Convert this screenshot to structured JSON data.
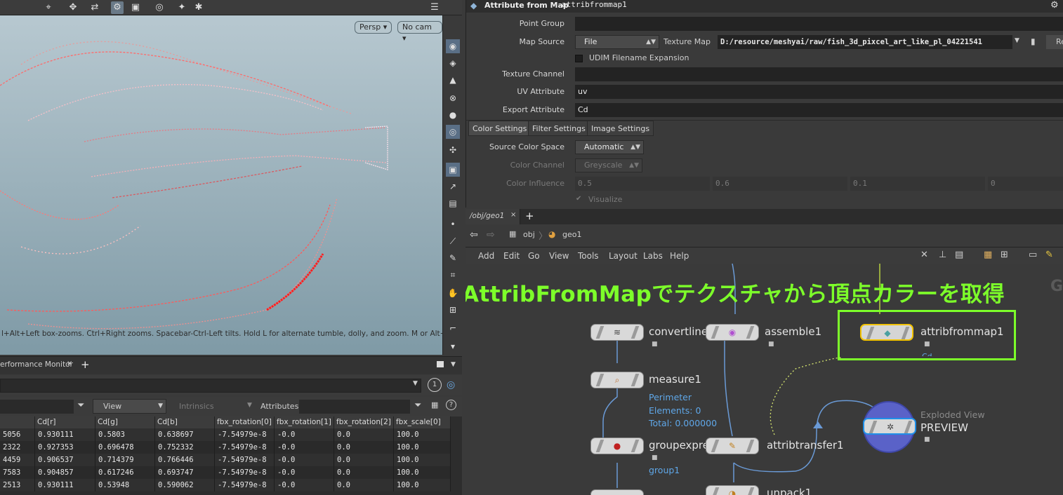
{
  "viewport": {
    "persp_label": "Persp ▾",
    "cam_label": "No cam ▾",
    "hint": "l+Alt+Left box-zooms. Ctrl+Right zooms. Spacebar-Ctrl-Left tilts. Hold L for alternate tumble, dolly, and zoom. M or Alt+M for"
  },
  "bottom_left": {
    "tab_label": "erformance Monitor",
    "add_tab": "+",
    "help_btn": "1",
    "view_dropdown": "View",
    "intrinsics_label": "Intrinsics",
    "attributes_label": "Attributes:",
    "columns": [
      "Cd[r]",
      "Cd[g]",
      "Cd[b]",
      "fbx_rotation[0]",
      "fbx_rotation[1]",
      "fbx_rotation[2]",
      "fbx_scale[0]"
    ],
    "rows": [
      [
        "5056",
        "0.930111",
        "0.5803",
        "0.638697",
        "-7.54979e-8",
        "-0.0",
        "0.0",
        "100.0"
      ],
      [
        "2322",
        "0.927353",
        "0.696478",
        "0.752332",
        "-7.54979e-8",
        "-0.0",
        "0.0",
        "100.0"
      ],
      [
        "4459",
        "0.906537",
        "0.714379",
        "0.766446",
        "-7.54979e-8",
        "-0.0",
        "0.0",
        "100.0"
      ],
      [
        "7583",
        "0.904857",
        "0.617246",
        "0.693747",
        "-7.54979e-8",
        "-0.0",
        "0.0",
        "100.0"
      ],
      [
        "2513",
        "0.930111",
        "0.53948",
        "0.590062",
        "-7.54979e-8",
        "-0.0",
        "0.0",
        "100.0"
      ]
    ]
  },
  "params": {
    "node_type": "Attribute from Map",
    "node_name": "attribfrommap1",
    "point_group_label": "Point Group",
    "map_source_label": "Map Source",
    "map_source_value": "File",
    "texture_map_label": "Texture Map",
    "texture_map_value": "D:/resource/meshyai/raw/fish_3d_pixcel_art_like_pl_04221541",
    "reload_label": "Re",
    "udim_label": "UDIM Filename Expansion",
    "texture_channel_label": "Texture Channel",
    "uv_attribute_label": "UV Attribute",
    "uv_attribute_value": "uv",
    "export_attribute_label": "Export Attribute",
    "export_attribute_value": "Cd",
    "tabs": [
      "Color Settings",
      "Filter Settings",
      "Image Settings"
    ],
    "source_color_space_label": "Source Color Space",
    "source_color_space_value": "Automatic",
    "color_channel_label": "Color Channel",
    "color_channel_value": "Greyscale",
    "color_influence_label": "Color Influence",
    "color_influence_values": [
      "0.5",
      "0.6",
      "0.1",
      "0"
    ],
    "visualize_label": "Visualize"
  },
  "network": {
    "tab_label": "/obj/geo1",
    "tab_close": "×",
    "add_tab": "+",
    "path": [
      "obj",
      "geo1"
    ],
    "menu": [
      "Add",
      "Edit",
      "Go",
      "View",
      "Tools",
      "Layout",
      "Labs",
      "Help"
    ],
    "banner": "AttribFromMapでテクスチャから頂点カラーを取得",
    "corner_letter": "G",
    "nodes": {
      "convertline": "convertline",
      "assemble": "assemble1",
      "attribfrommap": "attribfrommap1",
      "attribfrommap_sub": "Cd",
      "measure": "measure1",
      "groupexpr": "groupexpre",
      "group_sub": "group1",
      "attribtransfer": "attribtransfer1",
      "unpack": "unpack1",
      "preview_caption": "Exploded View",
      "preview_name": "PREVIEW"
    },
    "measure_info": [
      "Perimeter",
      "Elements: 0",
      "Total: 0.000000"
    ]
  },
  "colors": {
    "banner": "#7dff2a",
    "highlight_box": "#7dff2a",
    "selected_node": "#f2c200",
    "info_text": "#5fa7e8",
    "wire": "#6a9ad6"
  }
}
